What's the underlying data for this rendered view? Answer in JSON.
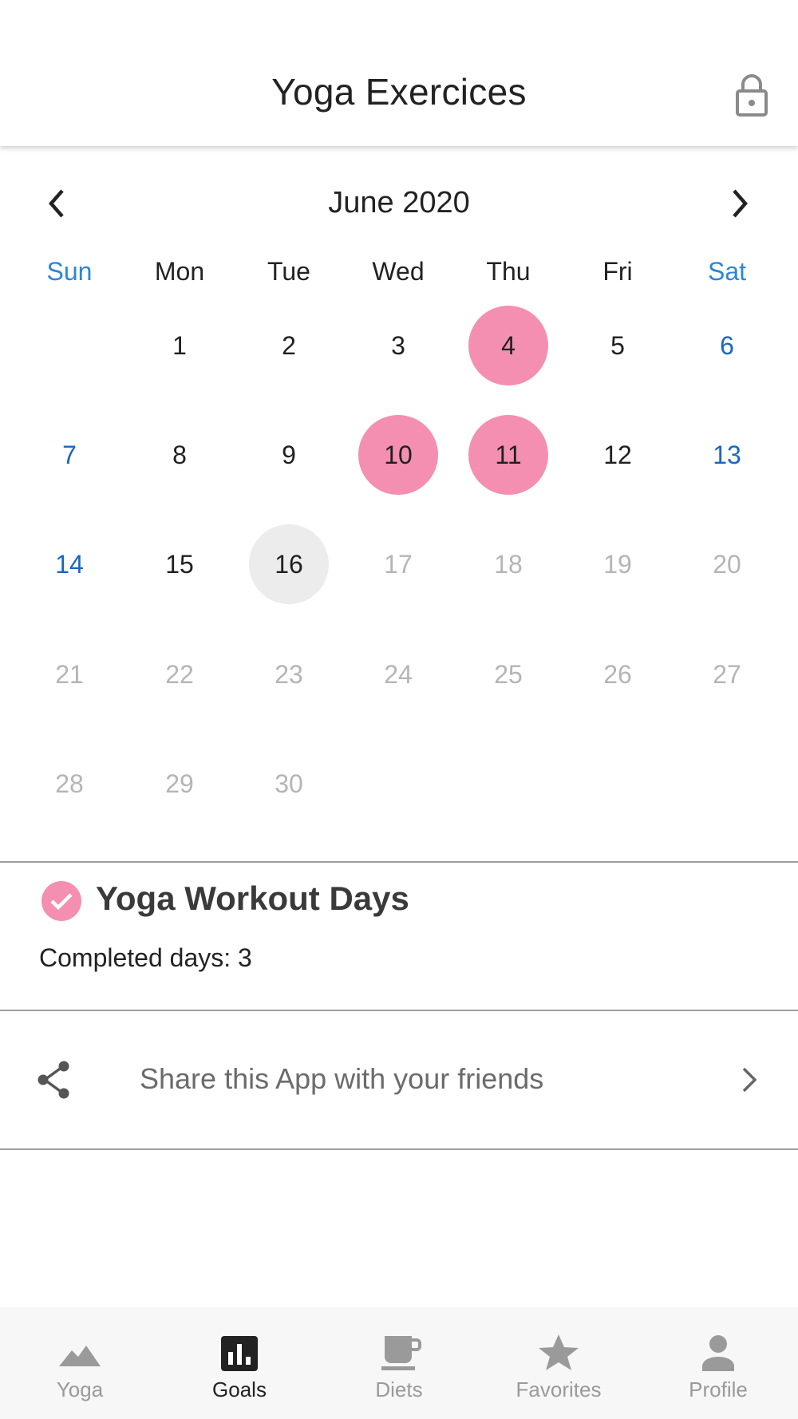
{
  "app_bar": {
    "title": "Yoga Exercices",
    "lock_icon": "lock-icon"
  },
  "calendar": {
    "month_label": "June 2020",
    "prev_icon": "chevron-left-icon",
    "next_icon": "chevron-right-icon",
    "weekdays": [
      "Sun",
      "Mon",
      "Tue",
      "Wed",
      "Thu",
      "Fri",
      "Sat"
    ],
    "first_weekday_index": 1,
    "days_in_month": 30,
    "today": 16,
    "completed_days": [
      4,
      10,
      11
    ],
    "colors": {
      "weekend_header": "#2b86d8",
      "weekend_day": "#1a66c0",
      "completed": "#f48fb1",
      "today": "#ececec",
      "future": "#b5b5b5"
    }
  },
  "goal": {
    "title": "Yoga Workout Days",
    "completed_text": "Completed days: 3",
    "badge_icon": "check-circle-icon"
  },
  "share": {
    "label": "Share this App with your friends",
    "icon": "share-icon",
    "chevron_icon": "chevron-right-icon"
  },
  "bottom_nav": {
    "items": [
      {
        "label": "Yoga",
        "icon": "mountain-icon",
        "active": false
      },
      {
        "label": "Goals",
        "icon": "bar-chart-icon",
        "active": true
      },
      {
        "label": "Diets",
        "icon": "coffee-cup-icon",
        "active": false
      },
      {
        "label": "Favorites",
        "icon": "star-icon",
        "active": false
      },
      {
        "label": "Profile",
        "icon": "person-icon",
        "active": false
      }
    ]
  }
}
